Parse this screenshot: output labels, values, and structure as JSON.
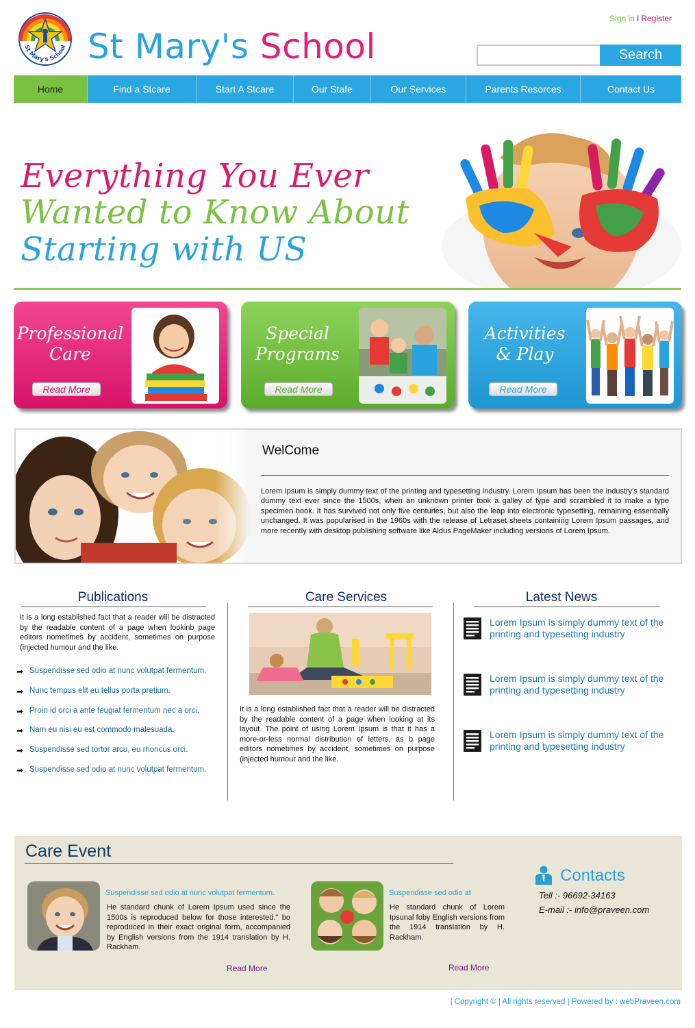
{
  "header": {
    "title_part1": "St Mary's",
    "title_part2": "School",
    "logo_text": "St Mary's School",
    "sign_in": "Sign in",
    "separator": "I",
    "register": "Register",
    "search_button": "Search",
    "search_value": ""
  },
  "nav": {
    "items": [
      "Home",
      "Find a Stcare",
      "Start A Stcare",
      "Our Stafe",
      "Our Services",
      "Parents Resorces",
      "Contact Us"
    ],
    "active": "Home"
  },
  "hero": {
    "line1": "Everything You Ever",
    "line2": "Wanted to Know About",
    "line3": "Starting with US",
    "colors": [
      "#d81b6b",
      "#7bc143",
      "#29a3dd"
    ]
  },
  "cards": [
    {
      "title_line1": "Professional",
      "title_line2": "Care",
      "button": "Read More",
      "color": "#e1206f"
    },
    {
      "title_line1": "Special",
      "title_line2": "Programs",
      "button": "Read More",
      "color": "#6dbb38"
    },
    {
      "title_line1": "Activities",
      "title_line2": "& Play",
      "button": "Read More",
      "color": "#2aa6e0"
    }
  ],
  "welcome": {
    "title": "WelCome",
    "text": "Lorem Ipsum is simply dummy text of the printing and typesetting industry. Lorem Ipsum has been the industry's standard dummy text ever since the 1500s, when an unknown printer took a galley of type and scrambled it to make a type specimen book. It has survived not only five centuries, but also the leap into electronic typesetting, remaining essentially unchanged. It was popularised in the 1960s with the release of Letraset sheets containing Lorem Ipsum passages, and more recently with desktop publishing software like Aldus PageMaker including versions of Lorem Ipsum."
  },
  "publications": {
    "title": "Publications",
    "text": "It is a long established fact that a reader will be distracted by the readable content of a page when lookinb page editors nometimes by accident, sometimes on purpose (injected humour and the like.",
    "links": [
      "Suspendisse sed odio at nunc volutpat fermentum.",
      "Nunc tempus elit eu tellus porta pretium.",
      "Proin id orci a ante feugiat fermentum nec a orci.",
      "Nam eu nisi eu est commodo malesuada.",
      "Suspendisse sed tortor arcu, eu rhoncus orci.",
      "Suspendisse sed odio at nunc volutpat fermentum."
    ]
  },
  "care_services": {
    "title": "Care Services",
    "text": "It is a long established fact that a reader will be distracted by the readable content of a page when looking at its layout. The point of using Lorem Ipsum is that it has a more-or-less normal distribution of letters, as b page editors nometimes by accident, sometimes on purpose (injected humour and the like."
  },
  "latest_news": {
    "title": "Latest News",
    "items": [
      "Lorem Ipsum is simply dummy text of the printing and typesetting industry",
      "Lorem Ipsum is simply dummy text of the printing and typesetting industry",
      "Lorem Ipsum is simply dummy text of the printing and typesetting industry"
    ]
  },
  "care_event": {
    "title": "Care Event",
    "events": [
      {
        "heading": "Suspendisse sed odio at nunc volutpat fermentum.",
        "text": "He standard chunk of Lorem Ipsum used since the 1500s is reproduced below for those interested.\" bo reproduced in their exact original form, accompanied by English versions from the 1914 translation by H. Rackham.",
        "read_more": "Read More"
      },
      {
        "heading": "Suspendisse sed odio at",
        "text": "He standard chunk of Lorem Ipsunal foby English versions from the 1914 translation by H. Rackham.",
        "read_more": "Read More"
      }
    ]
  },
  "contacts": {
    "title": "Contacts",
    "tel": "Tell :-  96692-34163",
    "email": "E-mail :-  info@praveen.com"
  },
  "footer": {
    "text": "| Copyright © | All rights reserved | Powered by : webPraveen.com"
  }
}
